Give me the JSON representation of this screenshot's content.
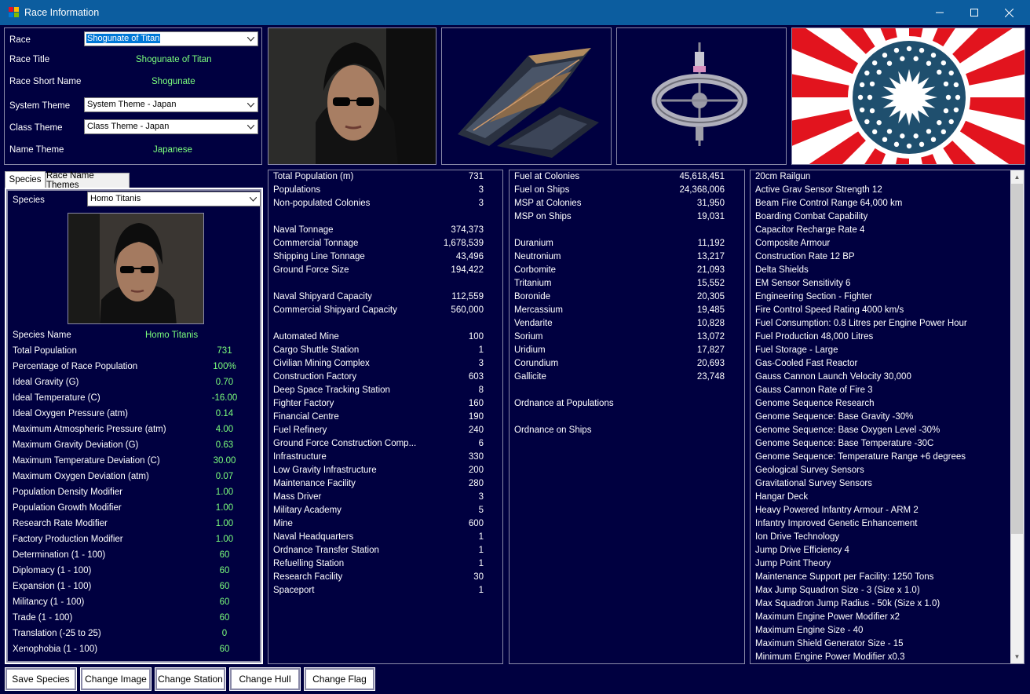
{
  "window": {
    "title": "Race Information"
  },
  "race_panel": {
    "race_label": "Race",
    "race_value": "Shogunate of Titan",
    "race_title_label": "Race Title",
    "race_title_value": "Shogunate of Titan",
    "race_short_label": "Race Short Name",
    "race_short_value": "Shogunate",
    "system_theme_label": "System Theme",
    "system_theme_value": "System Theme - Japan",
    "class_theme_label": "Class Theme",
    "class_theme_value": "Class Theme - Japan",
    "name_theme_label": "Name Theme",
    "name_theme_value": "Japanese"
  },
  "tabs": [
    "Species",
    "Race Name Themes"
  ],
  "species_panel": {
    "species_label": "Species",
    "species_value": "Homo Titanis",
    "name_label": "Species Name",
    "name_value": "Homo Titanis",
    "stats": [
      {
        "k": "Total Population",
        "v": "731"
      },
      {
        "k": "Percentage of Race Population",
        "v": "100%"
      },
      {
        "k": "Ideal Gravity (G)",
        "v": "0.70"
      },
      {
        "k": "Ideal Temperature (C)",
        "v": "-16.00"
      },
      {
        "k": "Ideal Oxygen Pressure (atm)",
        "v": "0.14"
      },
      {
        "k": "Maximum Atmospheric Pressure (atm)",
        "v": "4.00"
      },
      {
        "k": "Maximum Gravity Deviation (G)",
        "v": "0.63"
      },
      {
        "k": "Maximum Temperature Deviation (C)",
        "v": "30.00"
      },
      {
        "k": "Maximum Oxygen Deviation (atm)",
        "v": "0.07"
      },
      {
        "k": "Population Density Modifier",
        "v": "1.00"
      },
      {
        "k": "Population Growth Modifier",
        "v": "1.00"
      },
      {
        "k": "Research Rate Modifier",
        "v": "1.00"
      },
      {
        "k": "Factory Production Modifier",
        "v": "1.00"
      },
      {
        "k": "Determination (1 - 100)",
        "v": "60"
      },
      {
        "k": "Diplomacy (1 - 100)",
        "v": "60"
      },
      {
        "k": "Expansion (1 - 100)",
        "v": "60"
      },
      {
        "k": "Militancy (1 - 100)",
        "v": "60"
      },
      {
        "k": "Trade (1 - 100)",
        "v": "60"
      },
      {
        "k": "Translation (-25 to 25)",
        "v": "0"
      },
      {
        "k": "Xenophobia (1 - 100)",
        "v": "60"
      }
    ]
  },
  "population_list": [
    {
      "k": "Total Population (m)",
      "v": "731"
    },
    {
      "k": "Populations",
      "v": "3"
    },
    {
      "k": "Non-populated Colonies",
      "v": "3"
    },
    {
      "k": "",
      "v": ""
    },
    {
      "k": "Naval Tonnage",
      "v": "374,373"
    },
    {
      "k": "Commercial Tonnage",
      "v": "1,678,539"
    },
    {
      "k": "Shipping Line Tonnage",
      "v": "43,496"
    },
    {
      "k": "Ground Force Size",
      "v": "194,422"
    },
    {
      "k": "",
      "v": ""
    },
    {
      "k": "Naval Shipyard Capacity",
      "v": "112,559"
    },
    {
      "k": "Commercial Shipyard Capacity",
      "v": "560,000"
    },
    {
      "k": "",
      "v": ""
    },
    {
      "k": "Automated Mine",
      "v": "100"
    },
    {
      "k": "Cargo Shuttle Station",
      "v": "1"
    },
    {
      "k": "Civilian Mining Complex",
      "v": "3"
    },
    {
      "k": "Construction Factory",
      "v": "603"
    },
    {
      "k": "Deep Space Tracking Station",
      "v": "8"
    },
    {
      "k": "Fighter Factory",
      "v": "160"
    },
    {
      "k": "Financial Centre",
      "v": "190"
    },
    {
      "k": "Fuel Refinery",
      "v": "240"
    },
    {
      "k": "Ground Force Construction Comp...",
      "v": "6"
    },
    {
      "k": "Infrastructure",
      "v": "330"
    },
    {
      "k": "Low Gravity Infrastructure",
      "v": "200"
    },
    {
      "k": "Maintenance Facility",
      "v": "280"
    },
    {
      "k": "Mass Driver",
      "v": "3"
    },
    {
      "k": "Military Academy",
      "v": "5"
    },
    {
      "k": "Mine",
      "v": "600"
    },
    {
      "k": "Naval Headquarters",
      "v": "1"
    },
    {
      "k": "Ordnance Transfer Station",
      "v": "1"
    },
    {
      "k": "Refuelling Station",
      "v": "1"
    },
    {
      "k": "Research Facility",
      "v": "30"
    },
    {
      "k": "Spaceport",
      "v": "1"
    }
  ],
  "resources_list": [
    {
      "k": "Fuel at Colonies",
      "v": "45,618,451"
    },
    {
      "k": "Fuel on Ships",
      "v": "24,368,006"
    },
    {
      "k": "MSP at Colonies",
      "v": "31,950"
    },
    {
      "k": "MSP on Ships",
      "v": "19,031"
    },
    {
      "k": "",
      "v": ""
    },
    {
      "k": "Duranium",
      "v": "11,192"
    },
    {
      "k": "Neutronium",
      "v": "13,217"
    },
    {
      "k": "Corbomite",
      "v": "21,093"
    },
    {
      "k": "Tritanium",
      "v": "15,552"
    },
    {
      "k": "Boronide",
      "v": "20,305"
    },
    {
      "k": "Mercassium",
      "v": "19,485"
    },
    {
      "k": "Vendarite",
      "v": "10,828"
    },
    {
      "k": "Sorium",
      "v": "13,072"
    },
    {
      "k": "Uridium",
      "v": "17,827"
    },
    {
      "k": "Corundium",
      "v": "20,693"
    },
    {
      "k": "Gallicite",
      "v": "23,748"
    },
    {
      "k": "",
      "v": ""
    },
    {
      "k": "Ordnance at Populations",
      "v": ""
    },
    {
      "k": "",
      "v": ""
    },
    {
      "k": "Ordnance on Ships",
      "v": ""
    }
  ],
  "tech_list": [
    "20cm Railgun",
    "Active Grav Sensor Strength 12",
    "Beam Fire Control Range 64,000 km",
    "Boarding Combat Capability",
    "Capacitor Recharge Rate 4",
    "Composite Armour",
    "Construction Rate 12 BP",
    "Delta Shields",
    "EM Sensor Sensitivity 6",
    "Engineering Section - Fighter",
    "Fire Control Speed Rating 4000 km/s",
    "Fuel Consumption: 0.8 Litres per Engine Power Hour",
    "Fuel Production 48,000 Litres",
    "Fuel Storage - Large",
    "Gas-Cooled Fast Reactor",
    "Gauss Cannon Launch Velocity 30,000",
    "Gauss Cannon Rate of Fire 3",
    "Genome Sequence Research",
    "Genome Sequence: Base Gravity -30%",
    "Genome Sequence: Base Oxygen Level -30%",
    "Genome Sequence: Base Temperature -30C",
    "Genome Sequence: Temperature Range +6 degrees",
    "Geological Survey Sensors",
    "Gravitational Survey Sensors",
    "Hangar Deck",
    "Heavy Powered Infantry Armour - ARM 2",
    "Infantry Improved Genetic Enhancement",
    "Ion Drive Technology",
    "Jump Drive Efficiency 4",
    "Jump Point Theory",
    "Maintenance Support per Facility: 1250 Tons",
    "Max Jump Squadron Size - 3 (Size x 1.0)",
    "Max Squadron Jump Radius - 50k (Size x 1.0)",
    "Maximum Engine Power Modifier x2",
    "Maximum Engine Size - 40",
    "Maximum Shield Generator Size - 15",
    "Minimum Engine Power Modifier x0.3"
  ],
  "buttons": {
    "save_species": "Save Species",
    "change_image": "Change Image",
    "change_station": "Change Station",
    "change_hull": "Change Hull",
    "change_flag": "Change Flag"
  },
  "colors": {
    "background": "#000040",
    "titlebar": "#0c5d9f",
    "value_green": "#7cff7c",
    "flag_red": "#e2141e",
    "flag_blue": "#1f4f6e"
  }
}
